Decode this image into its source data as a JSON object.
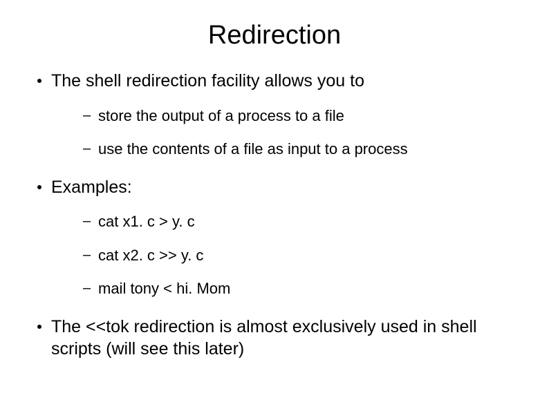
{
  "title": "Redirection",
  "bullets": [
    {
      "text": "The shell redirection facility allows you to",
      "children": [
        "store the output of a process to a file",
        "use the contents of a file as input to a process"
      ]
    },
    {
      "text": "Examples:",
      "children": [
        "cat x1. c > y. c",
        "cat x2. c >> y. c",
        "mail tony < hi. Mom"
      ]
    },
    {
      "text": "The <<tok redirection is almost exclusively used in shell scripts (will see this later)",
      "children": []
    }
  ]
}
